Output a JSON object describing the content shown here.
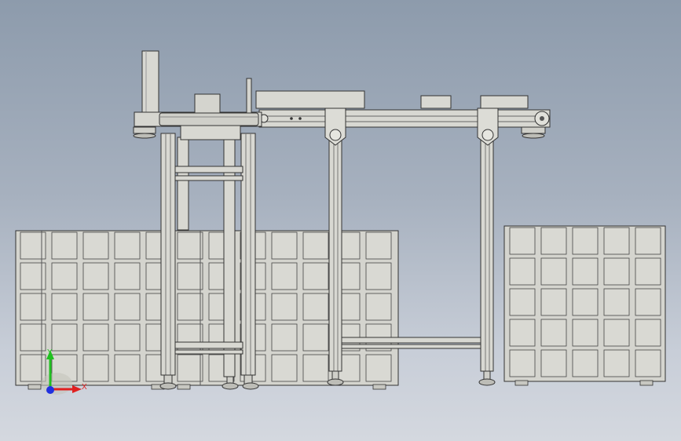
{
  "viewport": {
    "background_top": "#8d9bac",
    "background_bottom": "#d4d8df"
  },
  "model": {
    "frame_color": "#d6d6d0",
    "edge_color": "#3a3a3a",
    "shadow_color": "#9a9a94"
  },
  "triad": {
    "x_label": "X",
    "y_label": "Y",
    "x_color": "#e02020",
    "y_color": "#20c020",
    "z_color": "#2030e0"
  }
}
